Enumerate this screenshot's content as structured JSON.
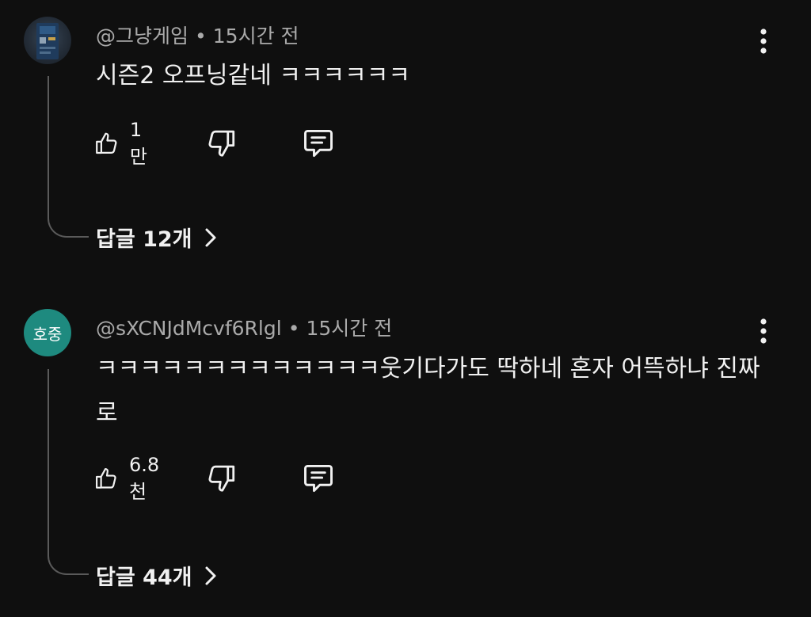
{
  "comments": [
    {
      "author": "@그냥게임",
      "time": "15시간 전",
      "text": "시즌2 오프닝같네 ㅋㅋㅋㅋㅋㅋ",
      "avatar": {
        "type": "image",
        "text": ""
      },
      "likes": "1만",
      "replies_label": "답글 12개"
    },
    {
      "author": "@sXCNJdMcvf6Rlgl",
      "time": "15시간 전",
      "text": "ㅋㅋㅋㅋㅋㅋㅋㅋㅋㅋㅋㅋㅋ웃기다가도 딱하네 혼자 어뜩하냐 진짜로",
      "avatar": {
        "type": "text",
        "text": "호중",
        "color": "#1e8a7f"
      },
      "likes": "6.8천",
      "replies_label": "답글 44개"
    }
  ],
  "separator": "•",
  "icons": {
    "more": "more-vert-icon",
    "like": "thumbs-up-icon",
    "dislike": "thumbs-down-icon",
    "reply": "reply-comment-icon",
    "chevron": "chevron-right-icon"
  },
  "colors": {
    "background": "#0f0f0f",
    "primary_text": "#f1f1f1",
    "secondary_text": "#aaaaaa",
    "thread_line": "#5a5a5a"
  }
}
